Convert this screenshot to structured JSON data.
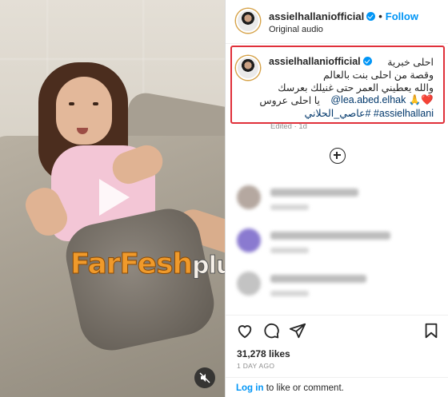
{
  "post": {
    "username": "assielhallaniofficial",
    "follow_label": "Follow",
    "separator": "•",
    "audio_label": "Original audio"
  },
  "caption": {
    "username": "assielhallaniofficial",
    "line1": "احلى خبرية",
    "line2": "وقصة من احلى بنت بالعالم",
    "line3": "والله يعطيني العمر حتى غنيلك بعرسك",
    "line4_mention": "@lea.abed.elhak",
    "line4_emoji": "🙏❤️",
    "line5": "يا احلى عروس",
    "line6": "assielhallani# #عاصي_الحلاني",
    "edited": "Edited · 1d"
  },
  "watermark": {
    "text_a": "FarFesh",
    "text_b": "plus.com"
  },
  "comments": [
    {
      "avatar_color": "#b5a8a0",
      "text_width": 110
    },
    {
      "avatar_color": "#8a7ad0",
      "text_width": 150
    },
    {
      "avatar_color": "#c3c3c3",
      "text_width": 120
    }
  ],
  "stats": {
    "likes": "31,278 likes",
    "time": "1 DAY AGO"
  },
  "footer": {
    "login_label": "Log in",
    "rest": " to like or comment."
  },
  "icons": [
    "play-icon",
    "mute-icon",
    "verified-badge-icon",
    "add-comment-icon",
    "heart-icon",
    "comment-icon",
    "share-icon",
    "bookmark-icon"
  ]
}
